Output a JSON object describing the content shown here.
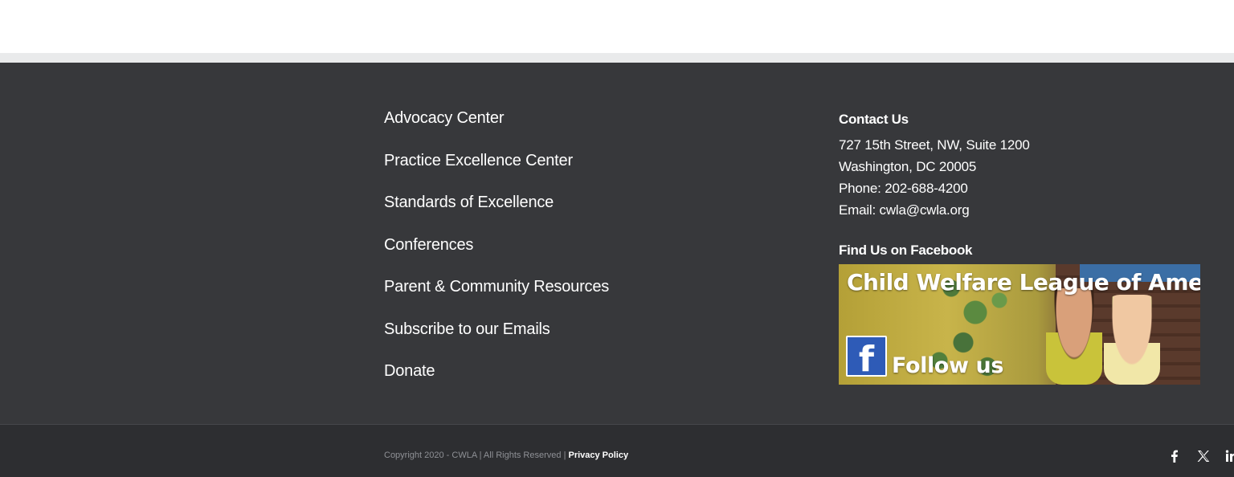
{
  "footer": {
    "nav_links": [
      "Advocacy Center",
      "Practice Excellence Center",
      "Standards of Excellence",
      "Conferences",
      "Parent & Community Resources",
      "Subscribe to our Emails",
      "Donate"
    ],
    "contact": {
      "heading": "Contact Us",
      "address_line1": "727 15th Street, NW, Suite 1200",
      "address_line2": "Washington, DC 20005",
      "phone": "Phone: 202-688-4200",
      "email": "Email: cwla@cwla.org"
    },
    "facebook": {
      "heading": "Find Us on Facebook",
      "banner_title": "Child Welfare League of America",
      "banner_cta": "Follow us",
      "logo_letter": "f"
    }
  },
  "bottom_bar": {
    "copyright": "Copyright 2020 - CWLA | All Rights Reserved | ",
    "privacy_label": "Privacy Policy",
    "social_icons": [
      "facebook-icon",
      "x-icon",
      "linkedin-icon"
    ]
  },
  "colors": {
    "footer_bg": "#37383b",
    "bottom_bg": "#2d2e31",
    "text": "#ffffff",
    "muted_text": "#8e9095",
    "facebook_blue": "#2e5bb7"
  }
}
